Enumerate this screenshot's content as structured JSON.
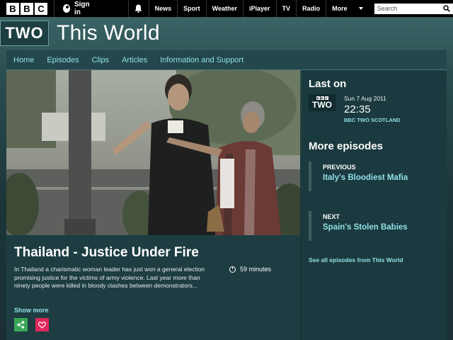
{
  "topbar": {
    "logo_letters": [
      "B",
      "B",
      "C"
    ],
    "signin_label": "Sign in",
    "nav": [
      "News",
      "Sport",
      "Weather",
      "iPlayer",
      "TV",
      "Radio",
      "More"
    ],
    "search_placeholder": "Search"
  },
  "brand": {
    "channel_badge": "TWO",
    "programme_title": "This World"
  },
  "subnav": [
    "Home",
    "Episodes",
    "Clips",
    "Articles",
    "Information and Support"
  ],
  "episode": {
    "title": "Thailand - Justice Under Fire",
    "description": "In Thailand a charismatic woman leader has just won a general election promising justice for the victims of army violence. Last year more than ninety people were killed in bloody clashes between demonstrators...",
    "duration": "59 minutes",
    "show_more": "Show more"
  },
  "side": {
    "last_on_heading": "Last on",
    "mini_badge_letters": [
      "B",
      "B",
      "C"
    ],
    "mini_badge_text": "TWO",
    "air_date": "Sun 7 Aug 2011",
    "air_time": "22:35",
    "channel": "BBC TWO SCOTLAND",
    "more_heading": "More episodes",
    "previous": {
      "kind": "PREVIOUS",
      "name": "Italy's Bloodiest Mafia"
    },
    "next": {
      "kind": "NEXT",
      "name": "Spain's Stolen Babies"
    },
    "see_all": "See all episodes from This World"
  },
  "colors": {
    "accent": "#8fe0e6",
    "share": "#3aa757",
    "favourite": "#e0265a"
  }
}
